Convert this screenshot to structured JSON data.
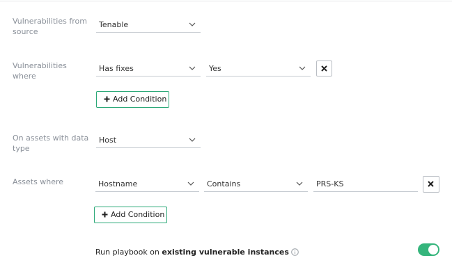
{
  "source_section": {
    "label": "Vulnerabilities from source",
    "select_value": "Tenable"
  },
  "vuln_conditions": {
    "label": "Vulnerabilities where",
    "rows": [
      {
        "field": "Has fixes",
        "value": "Yes"
      }
    ],
    "add_condition_label": "Add Condition"
  },
  "asset_type_section": {
    "label": "On assets with data type",
    "select_value": "Host"
  },
  "asset_conditions": {
    "label": "Assets where",
    "rows": [
      {
        "field": "Hostname",
        "operator": "Contains",
        "value": "PRS-KS"
      }
    ],
    "add_condition_label": "Add Condition"
  },
  "run_playbook": {
    "prefix": "Run playbook on ",
    "bold_text": "existing vulnerable instances",
    "enabled": true
  },
  "icons": {
    "chevron": "chevron-down-icon",
    "remove": "close-icon",
    "add": "plus-icon",
    "info": "info-icon"
  },
  "colors": {
    "accent_green": "#35b57c",
    "button_border_green": "#2aa877",
    "label_gray": "#8a9099"
  }
}
